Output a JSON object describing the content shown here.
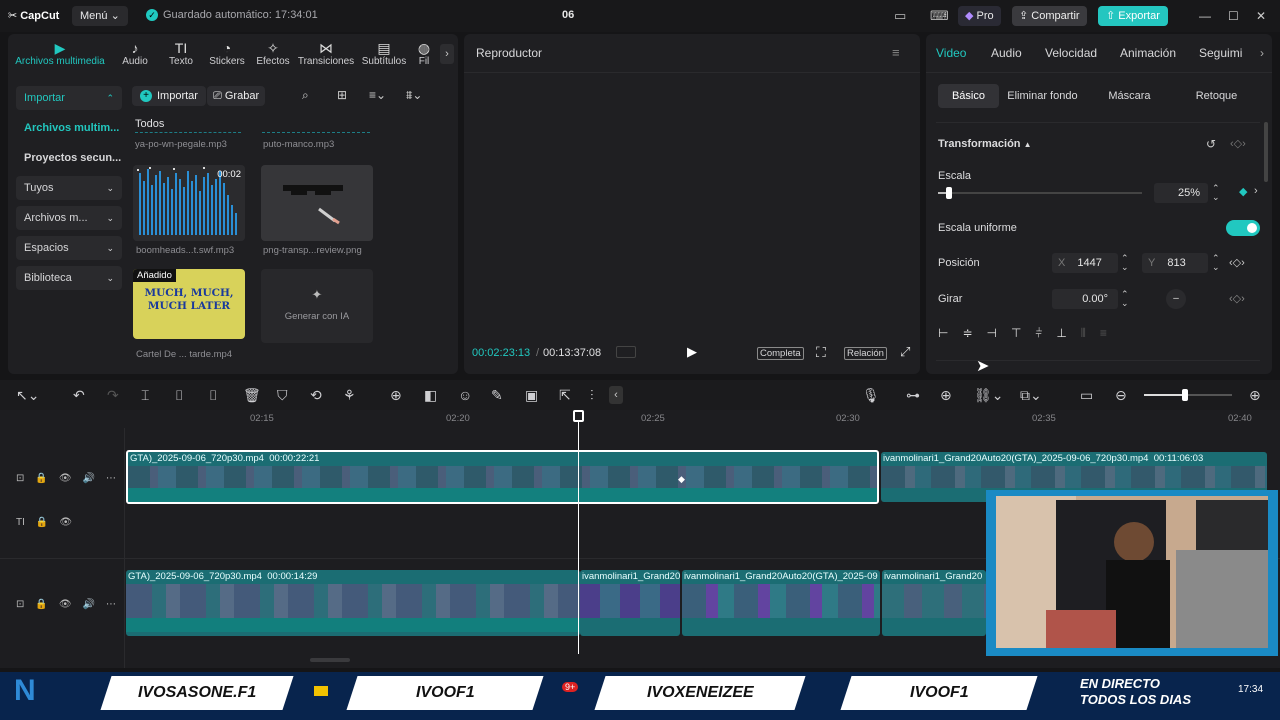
{
  "topbar": {
    "logo": "CapCut",
    "menu": "Menú",
    "autosave": "Guardado automático: 17:34:01",
    "project_title": "06",
    "pro": "Pro",
    "share": "Compartir",
    "export": "Exportar"
  },
  "media": {
    "tabs": [
      {
        "label": "Archivos multimedia",
        "icon": "media-icon"
      },
      {
        "label": "Audio",
        "icon": "audio-icon"
      },
      {
        "label": "Texto",
        "icon": "text-icon"
      },
      {
        "label": "Stickers",
        "icon": "sticker-icon"
      },
      {
        "label": "Efectos",
        "icon": "effects-icon"
      },
      {
        "label": "Transiciones",
        "icon": "transitions-icon"
      },
      {
        "label": "Subtítulos",
        "icon": "subtitles-icon"
      },
      {
        "label": "Fil",
        "icon": "filters-icon"
      }
    ],
    "sidebar": [
      {
        "label": "Importar"
      },
      {
        "label": "Archivos multim..."
      },
      {
        "label": "Proyectos secun..."
      },
      {
        "label": "Tuyos"
      },
      {
        "label": "Archivos m..."
      },
      {
        "label": "Espacios"
      },
      {
        "label": "Biblioteca"
      }
    ],
    "import_btn": "Importar",
    "record_btn": "Grabar",
    "section": "Todos",
    "files": [
      {
        "name": "ya-po-wn-pegale.mp3"
      },
      {
        "name": "puto-manco.mp3"
      },
      {
        "name": "boomheads...t.swf.mp3",
        "duration": "00:02"
      },
      {
        "name": "png-transp...review.png"
      },
      {
        "name": "Cartel De ... tarde.mp4",
        "badge": "Añadido",
        "thumb_text": "MUCH, MUCH, MUCH LATER"
      },
      {
        "name": "Generar con IA"
      }
    ]
  },
  "player": {
    "title": "Reproductor",
    "current_time": "00:02:23:13",
    "total_time": "00:13:37:08",
    "full_btn": "Completa",
    "ratio_btn": "Relación"
  },
  "props": {
    "tabs": [
      "Video",
      "Audio",
      "Velocidad",
      "Animación",
      "Seguimi"
    ],
    "subtabs": [
      "Básico",
      "Eliminar fondo",
      "Máscara",
      "Retoque"
    ],
    "transform_label": "Transformación",
    "scale_label": "Escala",
    "scale_value": "25%",
    "scale_fraction": 0.04,
    "uniform_label": "Escala uniforme",
    "position_label": "Posición",
    "pos_x_label": "X",
    "pos_x": "1447",
    "pos_y_label": "Y",
    "pos_y": "813",
    "rotate_label": "Girar",
    "rotate_value": "0.00°"
  },
  "timeline": {
    "ruler": [
      "02:15",
      "02:20",
      "02:25",
      "02:30",
      "02:35",
      "02:40"
    ],
    "clips": [
      {
        "label": "GTA)_2025-09-06_720p30.mp4",
        "duration": "00:00:22:21"
      },
      {
        "label": "ivanmolinari1_Grand20Auto20(GTA)_2025-09-06_720p30.mp4",
        "duration": "00:11:06:03"
      },
      {
        "label": "GTA)_2025-09-06_720p30.mp4",
        "duration": "00:00:14:29"
      },
      {
        "label": "ivanmolinari1_Grand20"
      },
      {
        "label": "ivanmolinari1_Grand20Auto20(GTA)_2025-09"
      },
      {
        "label": "ivanmolinari1_Grand20"
      }
    ]
  },
  "overlay": {
    "tags": [
      "IVOSASONE.F1",
      "IVOOF1",
      "IVOXENEIZEE",
      "IVOOF1"
    ],
    "live_text": "EN DIRECTO TODOS LOS DIAS",
    "clock": "17:34",
    "notif": "9+"
  },
  "colors": {
    "accent": "#21c8c0",
    "bg": "#151517",
    "panel": "#1f1f22",
    "clip": "#1e8a84"
  }
}
